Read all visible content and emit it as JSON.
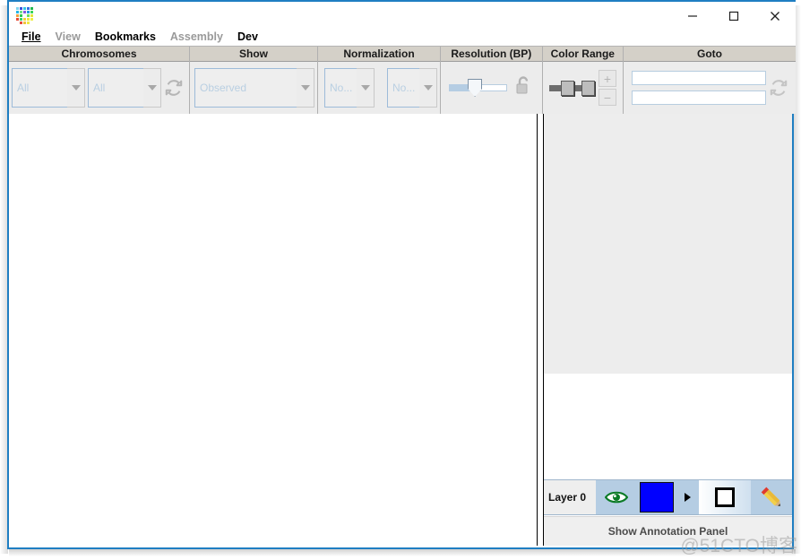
{
  "window": {
    "app_icon": "juicebox-pixel-icon",
    "controls": {
      "minimize": "minimize-icon",
      "maximize": "maximize-icon",
      "close": "close-icon"
    }
  },
  "menubar": {
    "items": [
      {
        "label": "File",
        "enabled": true,
        "mnemonic": "F"
      },
      {
        "label": "View",
        "enabled": false
      },
      {
        "label": "Bookmarks",
        "enabled": true
      },
      {
        "label": "Assembly",
        "enabled": false
      },
      {
        "label": "Dev",
        "enabled": true
      }
    ]
  },
  "toolbar": {
    "chromosomes": {
      "title": "Chromosomes",
      "combo_x_value": "All",
      "combo_y_value": "All",
      "refresh_icon": "refresh-icon"
    },
    "show": {
      "title": "Show",
      "combo_value": "Observed"
    },
    "normalization": {
      "title": "Normalization",
      "combo_row_value": "No...",
      "combo_col_value": "No..."
    },
    "resolution": {
      "title": "Resolution (BP)",
      "slider_percent": 45,
      "lock_icon": "unlocked-padlock-icon"
    },
    "color_range": {
      "title": "Color Range",
      "low_percent": 40,
      "high_percent": 86,
      "plus_label": "+",
      "minus_label": "−"
    },
    "goto": {
      "title": "Goto",
      "field1_value": "",
      "field1_placeholder": "",
      "field2_value": "",
      "field2_placeholder": "",
      "refresh_icon": "refresh-icon"
    }
  },
  "layer_panel": {
    "layer_label": "Layer 0",
    "eye_icon": "eye-visibility-icon",
    "color_swatch": "#0000ff",
    "expand_icon": "chevron-right-icon",
    "shape_icon": "square-outline-icon",
    "edit_icon": "pencil-icon"
  },
  "annotation_bar": {
    "label": "Show Annotation Panel"
  },
  "watermark": {
    "text": "@51CTO博客"
  }
}
